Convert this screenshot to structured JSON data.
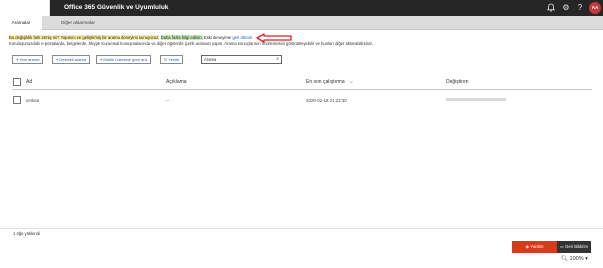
{
  "suite": {
    "title": "Office 365 Güvenlik ve Uyumluluk",
    "bell_icon": "bell-icon",
    "gear_icon": "gear-icon",
    "help_icon": "question-icon",
    "avatar_initials": "AA"
  },
  "tabs": [
    {
      "label": "Aramalar",
      "active": true
    },
    {
      "label": "Diğer aktarmalar",
      "active": false
    }
  ],
  "notice": {
    "part_yellow": "Bu değişiklik fark etmiş mi? Yapısını ve geliştirmiş bir arama deneyimi sunuyoruz.",
    "part_green": "Daha fazla bilgi edinin.",
    "part_plain": "Eski deneyime",
    "link": "geri dönün"
  },
  "description": "Kuruluşunuzdaki e-postalarda, belgelerde, Skype Kurumsal konuşmalarında ve diğer öğelerde içerik araması yapın. Arama sonuçlarının önizlemesini görüntüleyebilir ve bunları diğer aktarabilirsiniz.",
  "toolbar": {
    "new_search": "Yeni arama",
    "guided_search": "Destekli arama",
    "id_list_search": "Kimlik Listesine göre ara",
    "refresh": "Yenile",
    "search_value": "Arama"
  },
  "table": {
    "headers": {
      "name": "Ad",
      "description": "Açıklama",
      "last_run": "En son çalıştırma",
      "modified_by": "Değiştiren"
    },
    "rows": [
      {
        "name": "serkan",
        "description": "--",
        "last_run": "2020-02-18 21:22:30",
        "modified_by": ""
      }
    ]
  },
  "footer": {
    "count": "1 öğe yüklendi",
    "help_label": "Yardım",
    "feedback_label": "Geri Bildirim",
    "zoom": "100%"
  },
  "colors": {
    "suite_bar": "#262626",
    "accent_red": "#d43c1e",
    "link_blue": "#1a5fb4",
    "annotation_arrow": "#e02020"
  }
}
